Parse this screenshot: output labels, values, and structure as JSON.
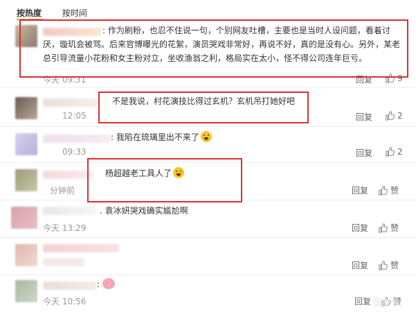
{
  "tabs": {
    "hot": "按热度",
    "time": "按时间"
  },
  "comments": [
    {
      "text_lines": [
        ": 作为刷粉，也忍不住说一句，个别网友吐槽，主要也是当时人设问题，看着讨",
        "厌，璇玑会被骂。后来官博曝光的花絮，演员哭戏非常好，再说不好，真的是没有心。另外，某老",
        "总引导流量小花粉和女主粉对立，坐收渔翁之利，格局实在太小，怪不得公司连年巨亏。"
      ],
      "time": "今天 09:31",
      "reply": "回复",
      "likes": "9"
    },
    {
      "text": "不是我说，村花演技比得过玄机？玄机吊打她好吧",
      "time": "12:05",
      "reply": "回复",
      "likes": "2"
    },
    {
      "text": ": 我陷在琉璃里出不来了",
      "time": "09:33",
      "reply": "回复",
      "likes": "2"
    },
    {
      "text": "杨超越老工具人了",
      "time": "分钟前",
      "reply": "回复",
      "likes": "赞"
    },
    {
      "text": ". 袁冰妍哭戏确实尴尬啊",
      "time": "今天 13:29",
      "reply": "回复",
      "likes": "赞"
    },
    {
      "text": "",
      "time": "",
      "reply": "回复",
      "likes": "赞"
    },
    {
      "text": ":",
      "time": "今天 10:56",
      "reply": "回复",
      "likes": "赞"
    }
  ],
  "watermark": "百家号/",
  "colors": {
    "accent": "#f0a030",
    "highlight_box": "#d63030"
  }
}
